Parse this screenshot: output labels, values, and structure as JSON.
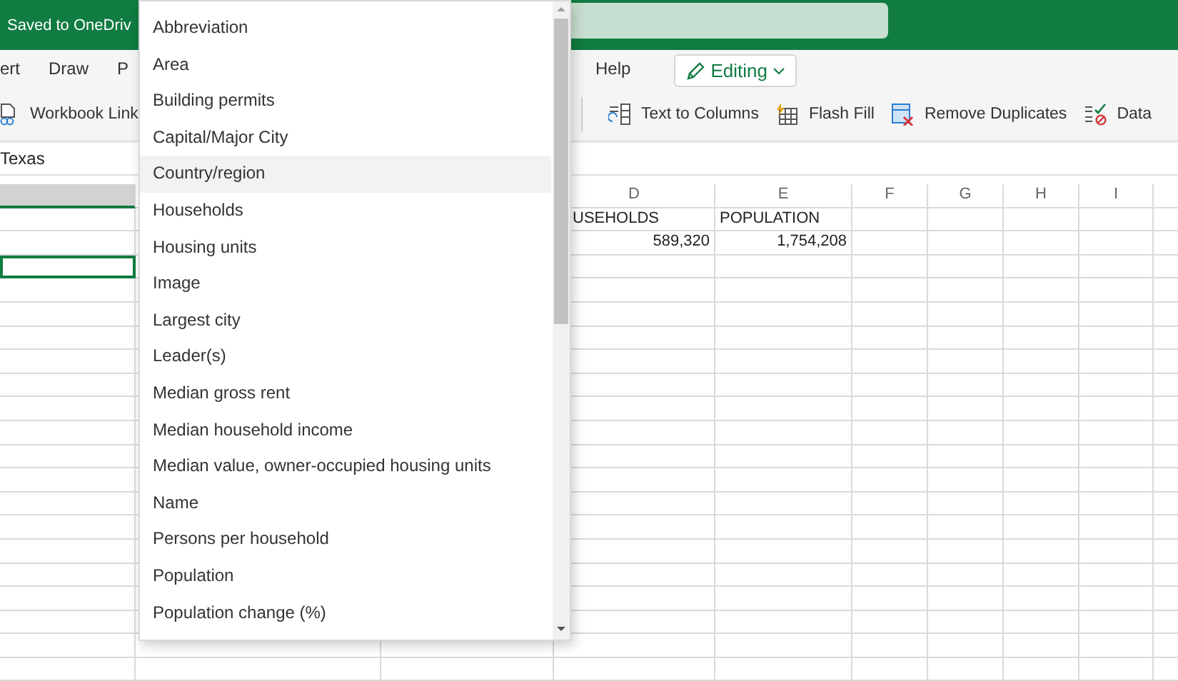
{
  "title_bar": {
    "status": "Saved to OneDriv"
  },
  "ribbon_tabs": [
    {
      "label": "ert",
      "selected": false
    },
    {
      "label": "Draw",
      "selected": false
    },
    {
      "label": "P",
      "selected": false
    },
    {
      "label": "Help",
      "selected": false
    }
  ],
  "mode_button": {
    "label": "Editing"
  },
  "toolbar": [
    {
      "label": "Workbook Link",
      "kind": "link"
    },
    {
      "label": "Text to Columns",
      "kind": "split"
    },
    {
      "label": "Flash Fill",
      "kind": "fill"
    },
    {
      "label": "Remove Duplicates",
      "kind": "dedupe"
    },
    {
      "label": "Data",
      "kind": "validate"
    }
  ],
  "formula_bar": {
    "value": "Texas"
  },
  "sheet": {
    "columns": [
      {
        "selected": true
      },
      {},
      {},
      {
        "label": "D",
        "selected": false
      },
      {
        "label": "E",
        "selected": false
      },
      {
        "label": "F",
        "selected": false
      },
      {
        "label": "G",
        "selected": false
      },
      {
        "label": "H",
        "selected": false
      },
      {
        "label": "I",
        "selected": false
      },
      {
        "selected": false
      }
    ],
    "rows": [
      {
        "cells": [
          null,
          null,
          null,
          {
            "text": "USEHOLDS",
            "kind": "text",
            "selected": false
          },
          {
            "text": "POPULATION",
            "kind": "text",
            "selected": false
          }
        ]
      },
      {
        "cells": [
          null,
          null,
          null,
          {
            "text": "589,320",
            "kind": "number",
            "selected": false
          },
          {
            "text": "1,754,208",
            "kind": "number",
            "selected": false
          }
        ]
      },
      {
        "cells": [
          {
            "selected": true
          }
        ]
      }
    ]
  },
  "dropdown": {
    "items": [
      {
        "label": "Abbreviation",
        "selected": false
      },
      {
        "label": "Area",
        "selected": false
      },
      {
        "label": "Building permits",
        "selected": false
      },
      {
        "label": "Capital/Major City",
        "selected": false
      },
      {
        "label": "Country/region",
        "selected": true
      },
      {
        "label": "Households",
        "selected": false
      },
      {
        "label": "Housing units",
        "selected": false
      },
      {
        "label": "Image",
        "selected": false
      },
      {
        "label": "Largest city",
        "selected": false
      },
      {
        "label": "Leader(s)",
        "selected": false
      },
      {
        "label": "Median gross rent",
        "selected": false
      },
      {
        "label": "Median household income",
        "selected": false
      },
      {
        "label": "Median value, owner-occupied housing units",
        "selected": false
      },
      {
        "label": "Name",
        "selected": false
      },
      {
        "label": "Persons per household",
        "selected": false
      },
      {
        "label": "Population",
        "selected": false
      },
      {
        "label": "Population change (%)",
        "selected": false
      }
    ]
  }
}
